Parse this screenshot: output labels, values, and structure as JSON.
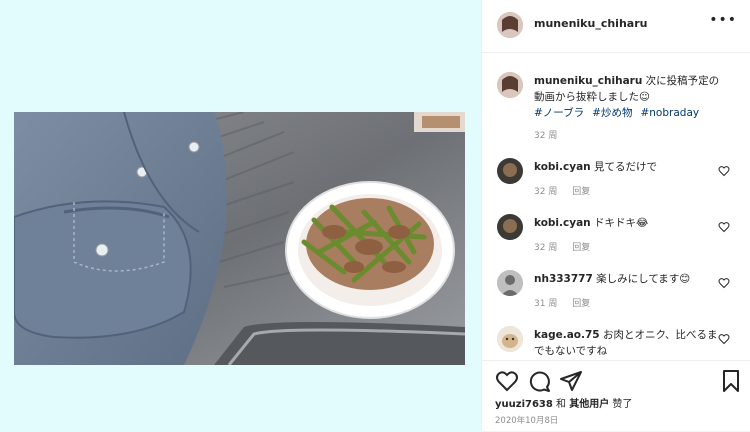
{
  "post": {
    "username": "muneniku_chiharu",
    "more_icon": "more-horizontal-icon"
  },
  "caption": {
    "username": "muneniku_chiharu",
    "text": "次に投稿予定の動画から抜粋しました☺︎",
    "tags": [
      "#ノーブラ",
      "#炒め物",
      "#nobraday"
    ],
    "time": "32 周"
  },
  "comments": [
    {
      "username": "kobi.cyan",
      "text": "見てるだけで",
      "time": "32 周",
      "reply": "回复"
    },
    {
      "username": "kobi.cyan",
      "text": "ドキドキ😂",
      "time": "32 周",
      "reply": "回复"
    },
    {
      "username": "nh333777",
      "text": "楽しみにしてます😊",
      "time": "31 周",
      "reply": "回复"
    },
    {
      "username": "kage.ao.75",
      "text": "お肉とオニク、比べるまでもないですね",
      "time": "",
      "reply": ""
    }
  ],
  "likes": {
    "user": "yuuzi7638",
    "and": "和",
    "others": "其他用户",
    "liked": "赞了"
  },
  "date": "2020年10月8日",
  "colors": {
    "background": "#e2fbfd",
    "hashtag": "#00376b",
    "muted": "#8e8e8e",
    "text": "#262626"
  }
}
